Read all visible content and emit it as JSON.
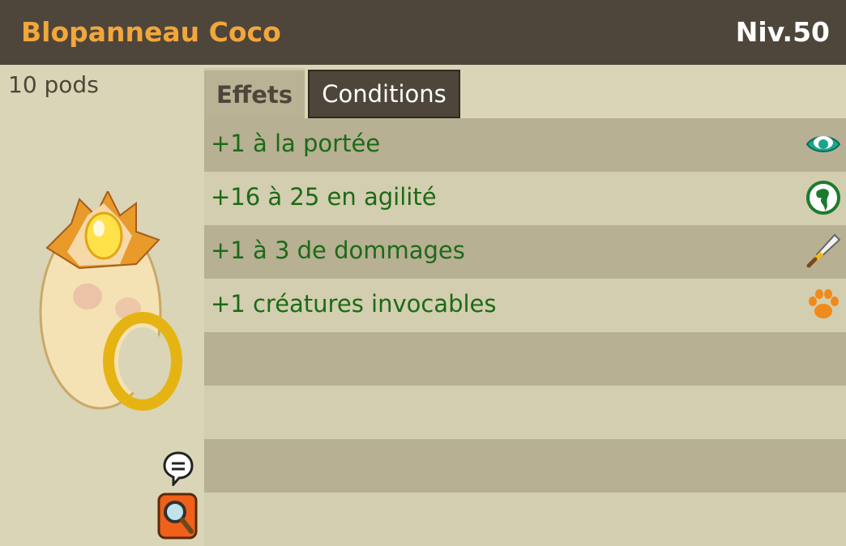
{
  "item": {
    "name": "Blopanneau Coco",
    "level": "Niv.50",
    "weight": "10 pods"
  },
  "tabs": [
    {
      "label": "Effets",
      "active": true
    },
    {
      "label": "Conditions",
      "active": false
    }
  ],
  "effects": [
    {
      "text": "+1 à la portée",
      "icon": "eye-icon"
    },
    {
      "text": "+16 à 25 en agilité",
      "icon": "agility-icon"
    },
    {
      "text": "+1 à 3 de dommages",
      "icon": "sword-icon"
    },
    {
      "text": "+1 créatures invocables",
      "icon": "paw-icon"
    }
  ],
  "colors": {
    "header_bg": "#4e463a",
    "title": "#f2a63c",
    "effect_text": "#1c6a17",
    "panel_bg": "#d9d5b6"
  }
}
